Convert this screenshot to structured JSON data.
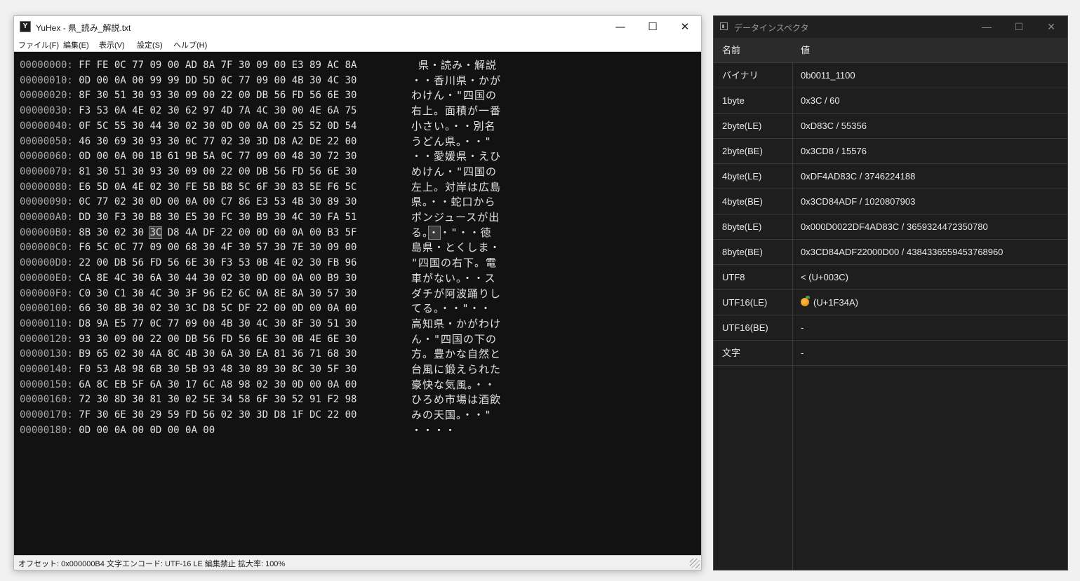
{
  "main_window": {
    "icon_text": "Y",
    "title": "YuHex - 県_読み_解説.txt",
    "controls": {
      "minimize": "—",
      "maximize": "☐",
      "close": "✕"
    },
    "menu": [
      "ファイル(F)",
      "編集(E)",
      "表示(V)",
      "設定(S)",
      "ヘルプ(H)"
    ],
    "hex_rows": [
      {
        "addr": "00000000:",
        "bytes": "FF FE 0C 77 09 00 AD 8A 7F 30 09 00 E3 89 AC 8A",
        "text": " 県・読み・解説"
      },
      {
        "addr": "00000010:",
        "bytes": "0D 00 0A 00 99 99 DD 5D 0C 77 09 00 4B 30 4C 30",
        "text": "・・香川県・かが"
      },
      {
        "addr": "00000020:",
        "bytes": "8F 30 51 30 93 30 09 00 22 00 DB 56 FD 56 6E 30",
        "text": "わけん・\"四国の"
      },
      {
        "addr": "00000030:",
        "bytes": "F3 53 0A 4E 02 30 62 97 4D 7A 4C 30 00 4E 6A 75",
        "text": "右上。面積が一番"
      },
      {
        "addr": "00000040:",
        "bytes": "0F 5C 55 30 44 30 02 30 0D 00 0A 00 25 52 0D 54",
        "text": "小さい。・・別名"
      },
      {
        "addr": "00000050:",
        "bytes": "46 30 69 30 93 30 0C 77 02 30 3D D8 A2 DE 22 00",
        "text": "うどん県。・・\""
      },
      {
        "addr": "00000060:",
        "bytes": "0D 00 0A 00 1B 61 9B 5A 0C 77 09 00 48 30 72 30",
        "text": "・・愛媛県・えひ"
      },
      {
        "addr": "00000070:",
        "bytes": "81 30 51 30 93 30 09 00 22 00 DB 56 FD 56 6E 30",
        "text": "めけん・\"四国の"
      },
      {
        "addr": "00000080:",
        "bytes": "E6 5D 0A 4E 02 30 FE 5B B8 5C 6F 30 83 5E F6 5C",
        "text": "左上。対岸は広島"
      },
      {
        "addr": "00000090:",
        "bytes": "0C 77 02 30 0D 00 0A 00 C7 86 E3 53 4B 30 89 30",
        "text": "県。・・蛇口から"
      },
      {
        "addr": "000000A0:",
        "bytes": "DD 30 F3 30 B8 30 E5 30 FC 30 B9 30 4C 30 FA 51",
        "text": "ポンジュースが出"
      },
      {
        "addr": "000000B0:",
        "bytes": "8B 30 02 30 3C D8 4A DF 22 00 0D 00 0A 00 B3 5F",
        "text": "る。・・\"・・徳",
        "sel_hex": 12,
        "sel_txt": 2
      },
      {
        "addr": "000000C0:",
        "bytes": "F6 5C 0C 77 09 00 68 30 4F 30 57 30 7E 30 09 00",
        "text": "島県・とくしま・"
      },
      {
        "addr": "000000D0:",
        "bytes": "22 00 DB 56 FD 56 6E 30 F3 53 0B 4E 02 30 FB 96",
        "text": "\"四国の右下。電"
      },
      {
        "addr": "000000E0:",
        "bytes": "CA 8E 4C 30 6A 30 44 30 02 30 0D 00 0A 00 B9 30",
        "text": "車がない。・・ス"
      },
      {
        "addr": "000000F0:",
        "bytes": "C0 30 C1 30 4C 30 3F 96 E2 6C 0A 8E 8A 30 57 30",
        "text": "ダチが阿波踊りし"
      },
      {
        "addr": "00000100:",
        "bytes": "66 30 8B 30 02 30 3C D8 5C DF 22 00 0D 00 0A 00",
        "text": "てる。・・\"・・"
      },
      {
        "addr": "00000110:",
        "bytes": "D8 9A E5 77 0C 77 09 00 4B 30 4C 30 8F 30 51 30",
        "text": "高知県・かがわけ"
      },
      {
        "addr": "00000120:",
        "bytes": "93 30 09 00 22 00 DB 56 FD 56 6E 30 0B 4E 6E 30",
        "text": "ん・\"四国の下の"
      },
      {
        "addr": "00000130:",
        "bytes": "B9 65 02 30 4A 8C 4B 30 6A 30 EA 81 36 71 68 30",
        "text": "方。豊かな自然と"
      },
      {
        "addr": "00000140:",
        "bytes": "F0 53 A8 98 6B 30 5B 93 48 30 89 30 8C 30 5F 30",
        "text": "台風に鍛えられた"
      },
      {
        "addr": "00000150:",
        "bytes": "6A 8C EB 5F 6A 30 17 6C A8 98 02 30 0D 00 0A 00",
        "text": "豪快な気風。・・"
      },
      {
        "addr": "00000160:",
        "bytes": "72 30 8D 30 81 30 02 5E 34 58 6F 30 52 91 F2 98",
        "text": "ひろめ市場は酒飲"
      },
      {
        "addr": "00000170:",
        "bytes": "7F 30 6E 30 29 59 FD 56 02 30 3D D8 1F DC 22 00",
        "text": "みの天国。・・\""
      },
      {
        "addr": "00000180:",
        "bytes": "0D 00 0A 00 0D 00 0A 00",
        "text": "・・・・"
      }
    ],
    "status": "オフセット: 0x000000B4  文字エンコード: UTF-16 LE  編集禁止  拡大率: 100%"
  },
  "inspector": {
    "title": "データインスペクタ",
    "controls": {
      "minimize": "—",
      "maximize": "☐",
      "close": "✕"
    },
    "header": {
      "name": "名前",
      "value": "値"
    },
    "rows": [
      {
        "name": "バイナリ",
        "value": "0b0011_1100"
      },
      {
        "name": "1byte",
        "value": "0x3C / 60"
      },
      {
        "name": "2byte(LE)",
        "value": "0xD83C / 55356"
      },
      {
        "name": "2byte(BE)",
        "value": "0x3CD8 / 15576"
      },
      {
        "name": "4byte(LE)",
        "value": "0xDF4AD83C / 3746224188"
      },
      {
        "name": "4byte(BE)",
        "value": "0x3CD84ADF / 1020807903"
      },
      {
        "name": "8byte(LE)",
        "value": "0x000D0022DF4AD83C / 3659324472350780"
      },
      {
        "name": "8byte(BE)",
        "value": "0x3CD84ADF22000D00 / 4384336559453768960"
      },
      {
        "name": "UTF8",
        "value": "< (U+003C)"
      },
      {
        "name": "UTF16(LE)",
        "value": "(U+1F34A)",
        "icon": "tangerine-icon"
      },
      {
        "name": "UTF16(BE)",
        "value": "-"
      },
      {
        "name": "文字",
        "value": "-"
      }
    ]
  }
}
